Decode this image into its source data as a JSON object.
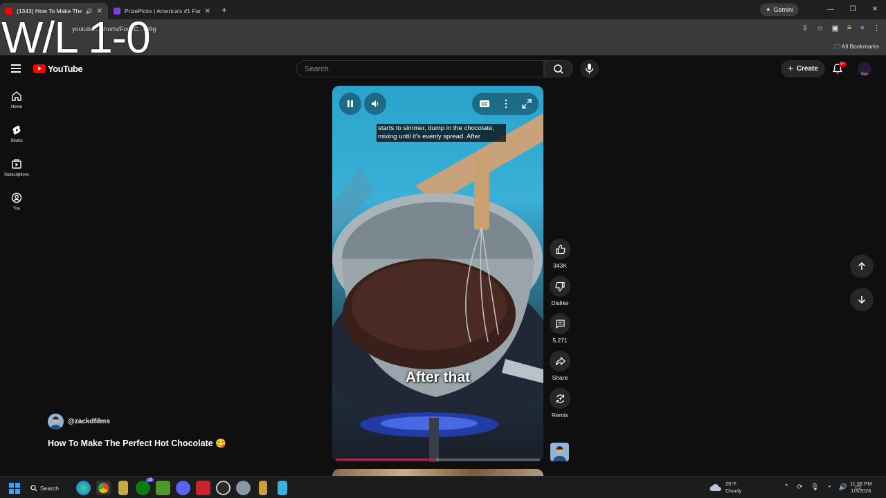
{
  "overlay_text": "W/L 1-0",
  "browser": {
    "tabs": [
      {
        "title": "(1343) How To Make The Pe",
        "active": true
      },
      {
        "title": "PrizePicks | America's #1 Fantas",
        "active": false
      }
    ],
    "gemini_label": "Gemini",
    "url": "youtube.../shorts/FouzC...Cj6g",
    "bookmarks_label": "All Bookmarks"
  },
  "youtube": {
    "logo_text": "YouTube",
    "search_placeholder": "Search",
    "create_label": "Create",
    "notification_badge": "9+",
    "avatar_text": "logo",
    "sidebar": [
      {
        "label": "Home",
        "icon": "home-icon"
      },
      {
        "label": "Shorts",
        "icon": "shorts-icon"
      },
      {
        "label": "Subscriptions",
        "icon": "subscriptions-icon"
      },
      {
        "label": "You",
        "icon": "you-icon"
      }
    ]
  },
  "video": {
    "caption_top": "starts to simmer, dump in the chocolate, mixing until it's evenly spread. After",
    "caption_big": "After that",
    "progress": 0.49
  },
  "actions": {
    "like_count": "343K",
    "dislike_label": "Dislike",
    "comment_count": "5,271",
    "share_label": "Share",
    "remix_label": "Remix"
  },
  "channel": {
    "handle": "@zackdfilms",
    "title": "How To Make The Perfect Hot Chocolate 😋"
  },
  "taskbar": {
    "search_label": "Search",
    "discord_badge": "18",
    "weather_temp": "25°F",
    "weather_desc": "Cloudy",
    "time": "11:58 PM",
    "date": "1/3/2026"
  },
  "colors": {
    "accent_red": "#ff0000",
    "progress_red": "#ff0033",
    "background": "#0f0f0f"
  }
}
